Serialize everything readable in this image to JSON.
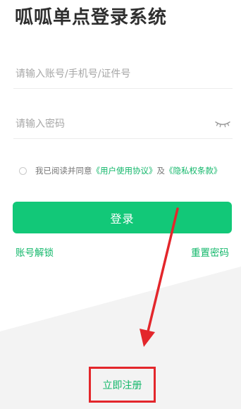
{
  "app": {
    "title": "呱呱单点登录系统"
  },
  "form": {
    "account_placeholder": "请输入账号/手机号/证件号",
    "account_value": "",
    "password_placeholder": "请输入密码",
    "password_value": "",
    "password_toggle_icon": "eye-closed-icon"
  },
  "agreement": {
    "prefix": "我已阅读并同意",
    "user_agreement": "《用户使用协议》",
    "and": "及",
    "privacy": "《隐私权条款》",
    "checked": false
  },
  "buttons": {
    "login": "登录",
    "unlock_account": "账号解锁",
    "reset_password": "重置密码",
    "register": "立即注册"
  },
  "colors": {
    "accent": "#12c878",
    "link": "#12b76a",
    "annotation": "#e3262b"
  }
}
